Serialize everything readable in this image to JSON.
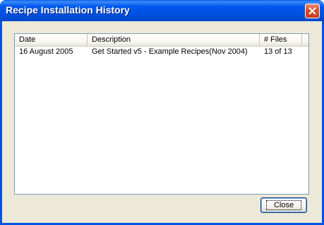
{
  "window": {
    "title": "Recipe Installation History",
    "close_icon": "close-icon"
  },
  "list": {
    "columns": [
      {
        "label": "Date"
      },
      {
        "label": "Description"
      },
      {
        "label": "# Files"
      }
    ],
    "rows": [
      {
        "date": "16 August 2005",
        "description": "Get Started v5 - Example Recipes(Nov 2004)",
        "files": "13 of 13"
      }
    ]
  },
  "buttons": {
    "close_label": "Close"
  },
  "colors": {
    "titlebar": "#0054e3",
    "close_button_red": "#d9512b",
    "dialog_face": "#ece9d8"
  }
}
